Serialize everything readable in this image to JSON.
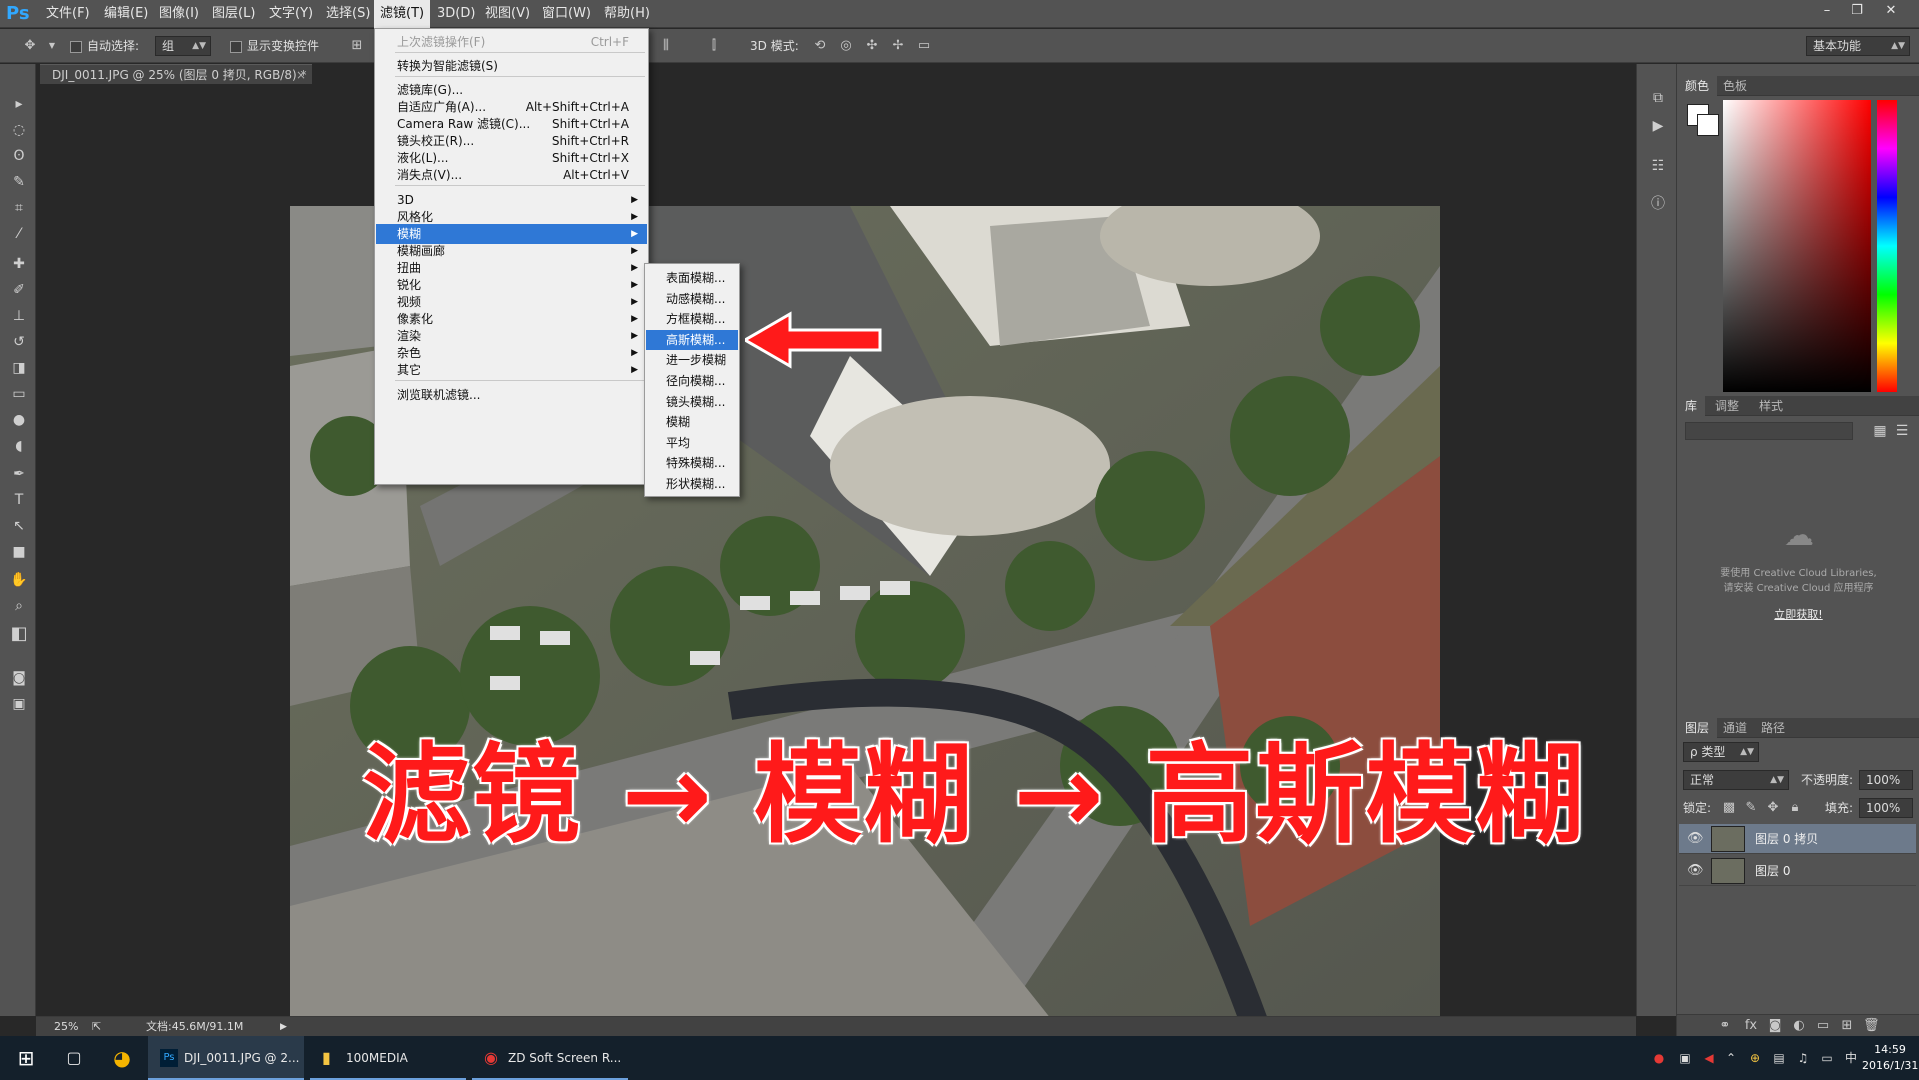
{
  "app": {
    "logo": "Ps",
    "menus": [
      "文件(F)",
      "编辑(E)",
      "图像(I)",
      "图层(L)",
      "文字(Y)",
      "选择(S)",
      "滤镜(T)",
      "3D(D)",
      "视图(V)",
      "窗口(W)",
      "帮助(H)"
    ],
    "active_menu": "滤镜(T)"
  },
  "options_bar": {
    "auto_select_label": "自动选择:",
    "auto_select_value": "组",
    "show_transform_label": "显示变换控件",
    "mode_3d_label": "3D 模式:",
    "workspace": "基本功能"
  },
  "document": {
    "tab_title": "DJI_0011.JPG @ 25% (图层 0 拷贝, RGB/8) *",
    "zoom": "25%",
    "doc_size": "文档:45.6M/91.1M"
  },
  "filter_menu": {
    "items": [
      {
        "label": "上次滤镜操作(F)",
        "shortcut": "Ctrl+F",
        "disabled": true
      },
      {
        "label": "转换为智能滤镜(S)",
        "shortcut": ""
      },
      {
        "label": "滤镜库(G)...",
        "shortcut": ""
      },
      {
        "label": "自适应广角(A)...",
        "shortcut": "Alt+Shift+Ctrl+A"
      },
      {
        "label": "Camera Raw 滤镜(C)...",
        "shortcut": "Shift+Ctrl+A"
      },
      {
        "label": "镜头校正(R)...",
        "shortcut": "Shift+Ctrl+R"
      },
      {
        "label": "液化(L)...",
        "shortcut": "Shift+Ctrl+X"
      },
      {
        "label": "消失点(V)...",
        "shortcut": "Alt+Ctrl+V"
      },
      {
        "label": "3D",
        "submenu": true
      },
      {
        "label": "风格化",
        "submenu": true
      },
      {
        "label": "模糊",
        "submenu": true,
        "highlighted": true
      },
      {
        "label": "模糊画廊",
        "submenu": true
      },
      {
        "label": "扭曲",
        "submenu": true
      },
      {
        "label": "锐化",
        "submenu": true
      },
      {
        "label": "视频",
        "submenu": true
      },
      {
        "label": "像素化",
        "submenu": true
      },
      {
        "label": "渲染",
        "submenu": true
      },
      {
        "label": "杂色",
        "submenu": true
      },
      {
        "label": "其它",
        "submenu": true
      },
      {
        "label": "浏览联机滤镜...",
        "shortcut": ""
      }
    ]
  },
  "blur_submenu": {
    "items": [
      "表面模糊...",
      "动感模糊...",
      "方框模糊...",
      "高斯模糊...",
      "进一步模糊",
      "径向模糊...",
      "镜头模糊...",
      "模糊",
      "平均",
      "特殊模糊...",
      "形状模糊..."
    ],
    "highlighted": "高斯模糊..."
  },
  "caption": {
    "part1": "滤镜",
    "arrow": "→",
    "part2": "模糊",
    "part3": "高斯模糊"
  },
  "color_panel": {
    "tabs": [
      "颜色",
      "色板"
    ]
  },
  "library_panel": {
    "tabs": [
      "库",
      "调整",
      "样式"
    ],
    "message_line1": "要使用 Creative Cloud Libraries,",
    "message_line2": "请安装 Creative Cloud 应用程序",
    "link": "立即获取!"
  },
  "layers_panel": {
    "tabs": [
      "图层",
      "通道",
      "路径"
    ],
    "filter_label": "ρ 类型",
    "blend_mode": "正常",
    "opacity_label": "不透明度:",
    "opacity_value": "100%",
    "lock_label": "锁定:",
    "fill_label": "填充:",
    "fill_value": "100%",
    "layers": [
      {
        "name": "图层 0 拷贝",
        "selected": true
      },
      {
        "name": "图层 0",
        "selected": false
      }
    ]
  },
  "taskbar": {
    "apps": [
      "DJI_0011.JPG @ 2...",
      "100MEDIA",
      "ZD Soft Screen R..."
    ],
    "ime": "中",
    "time": "14:59",
    "date": "2016/1/31"
  },
  "colors": {
    "menu_highlight": "#2f78d6",
    "caption_red": "#ff1a1a",
    "ps_blue": "#31a8ff"
  }
}
